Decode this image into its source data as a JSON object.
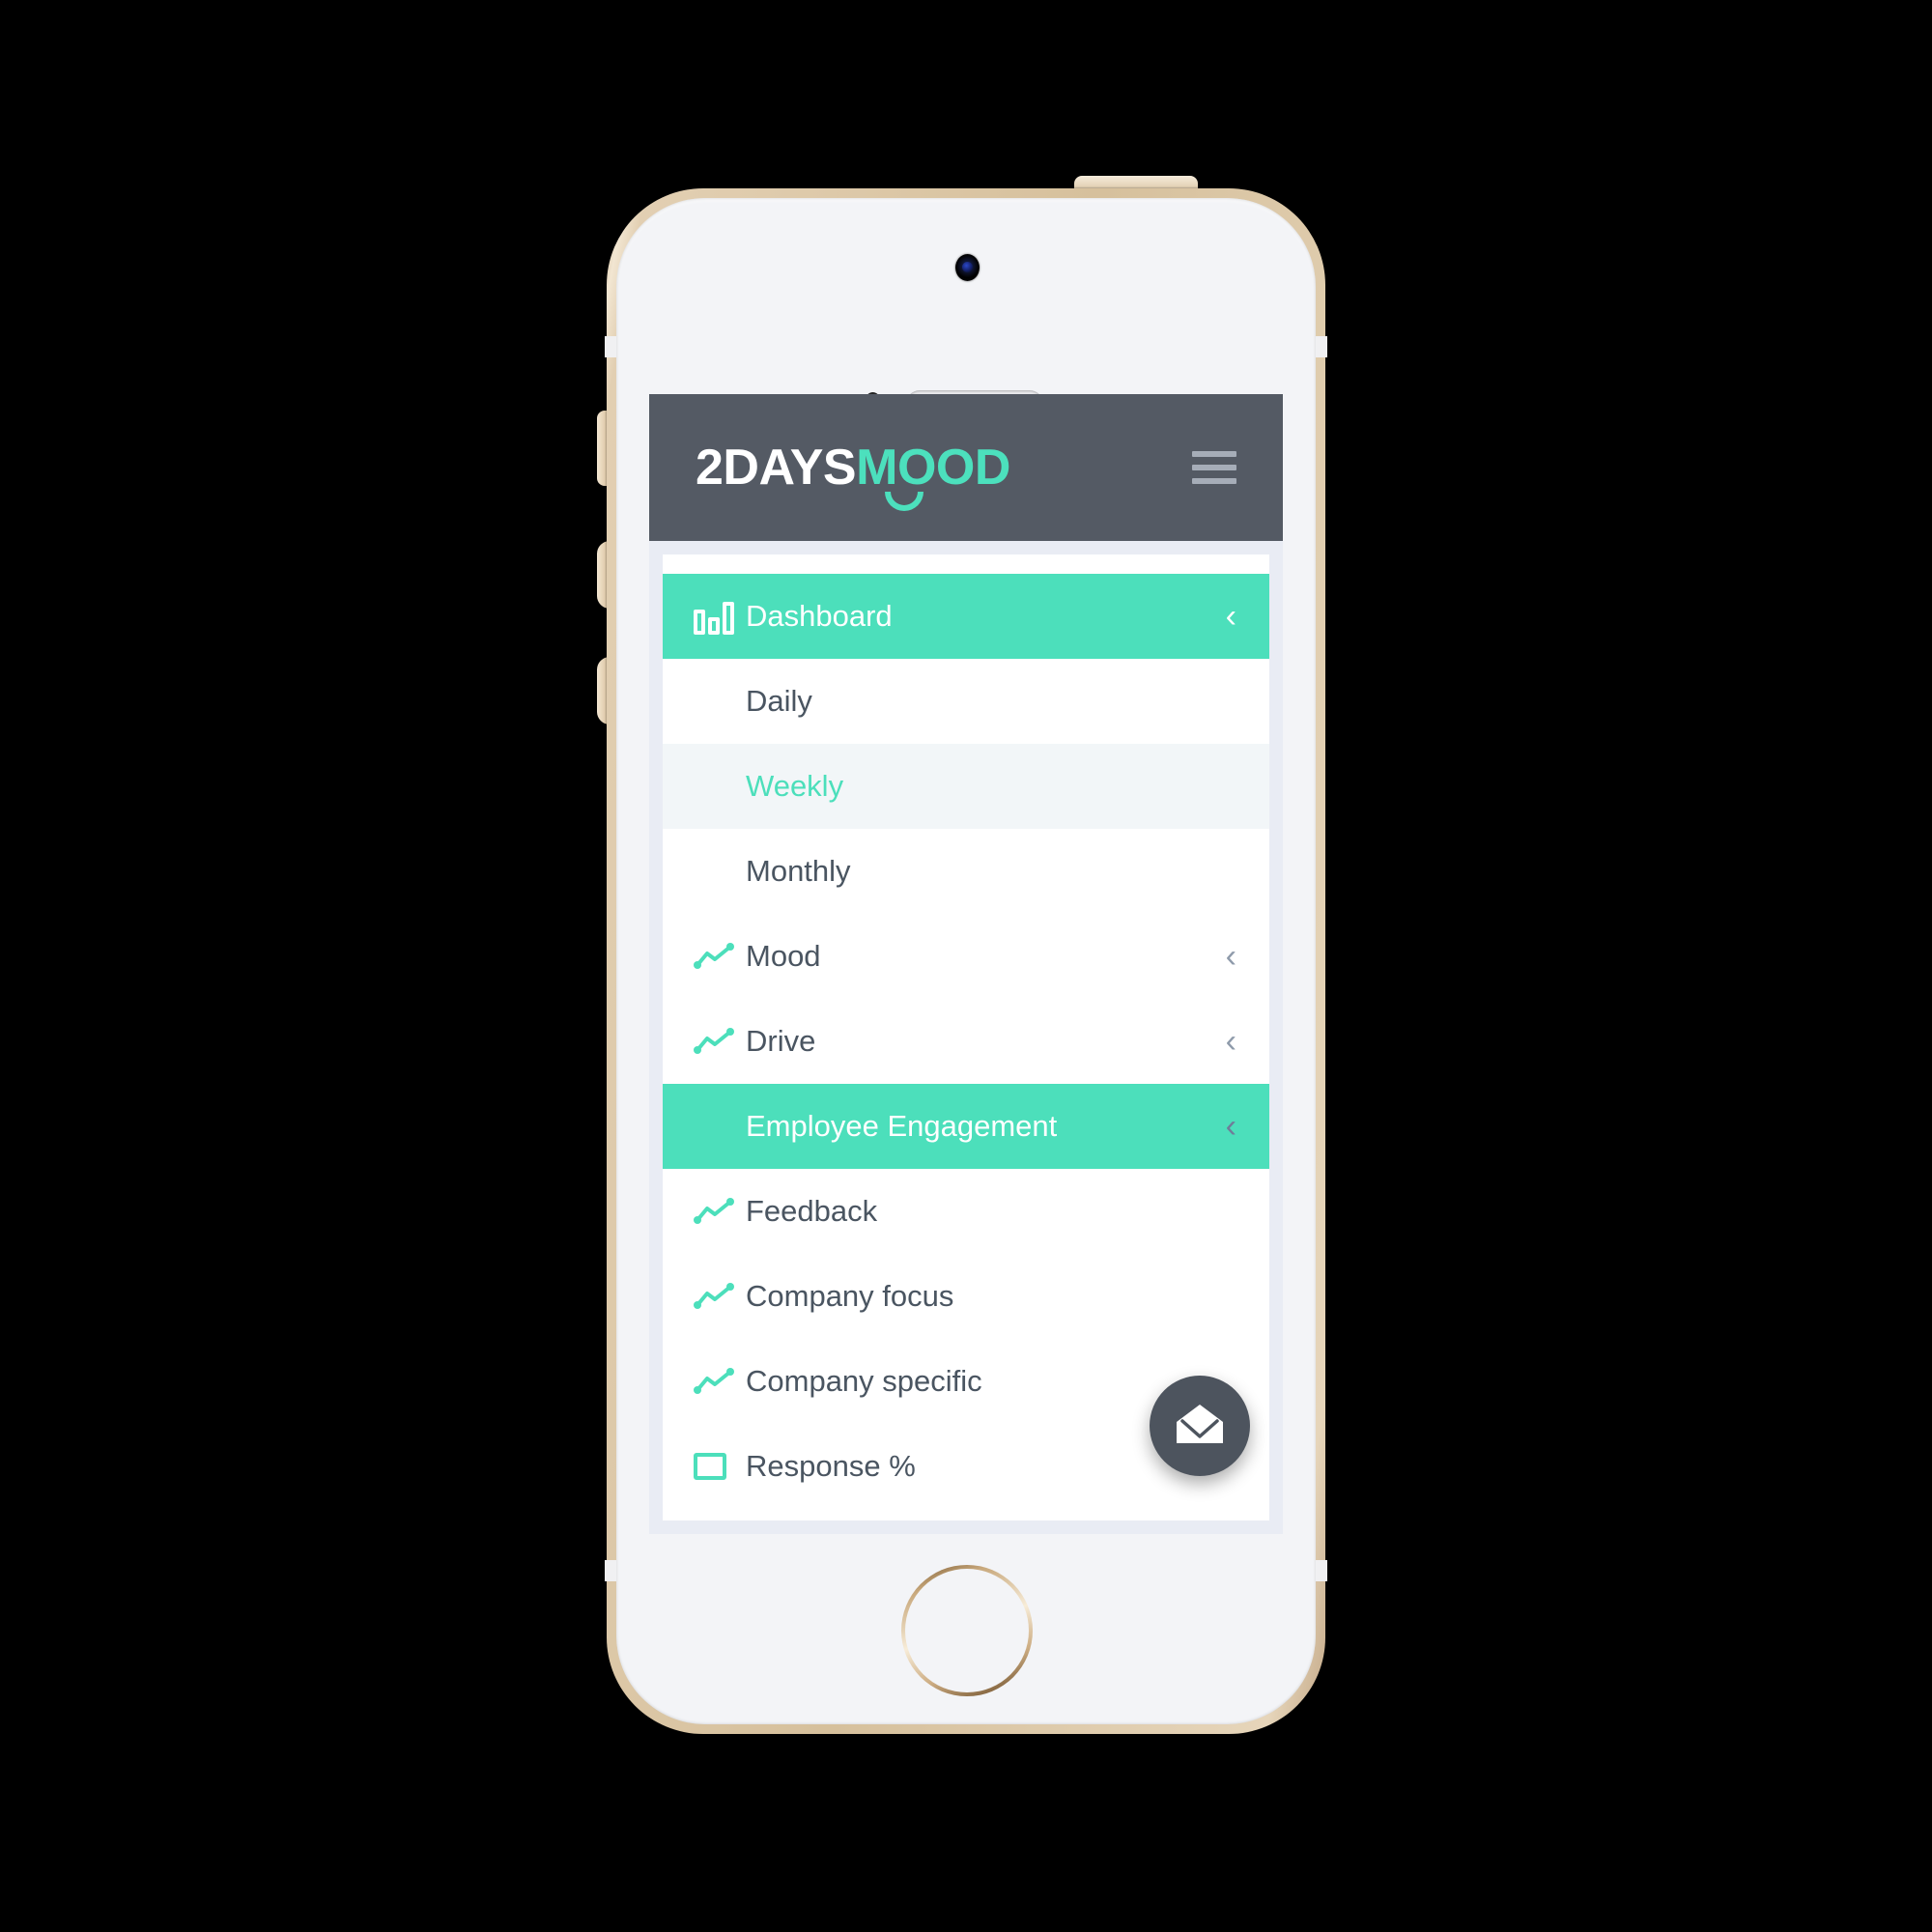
{
  "device": {
    "type": "iphone-5s-gold-mockup",
    "hardware": {
      "power_button": "power-button",
      "mute_switch": "mute-switch",
      "volume_up": "volume-up-button",
      "volume_down": "volume-down-button",
      "home_button": "home-button",
      "camera": "front-camera",
      "speaker": "earpiece-speaker",
      "proximity_sensor": "proximity-sensor"
    }
  },
  "colors": {
    "accent_green": "#4CDFBB",
    "header_slate": "#545A64",
    "text_slate": "#4A5561",
    "page_bg": "#E9ECF4",
    "selected_row_bg": "#F2F6F8",
    "fab_bg": "#4D545E",
    "chevron_gray": "#8F9BAB",
    "hamburger_gray": "#A6ADB8",
    "device_gold": "#D6C09C"
  },
  "header": {
    "logo_part_one": "2DAYS",
    "logo_part_two": "MOOD",
    "logo_smile_icon": "smile-curve-icon",
    "menu_button_icon": "hamburger-menu-icon"
  },
  "nav": {
    "items": [
      {
        "label": "Dashboard",
        "icon": "bar-chart-icon",
        "chevron": "‹",
        "state": "active",
        "level": "top"
      },
      {
        "label": "Daily",
        "icon": null,
        "chevron": null,
        "state": "normal",
        "level": "sub"
      },
      {
        "label": "Weekly",
        "icon": null,
        "chevron": null,
        "state": "selected",
        "level": "sub"
      },
      {
        "label": "Monthly",
        "icon": null,
        "chevron": null,
        "state": "normal",
        "level": "sub"
      },
      {
        "label": "Mood",
        "icon": "line-chart-icon",
        "chevron": "‹",
        "state": "normal",
        "level": "top"
      },
      {
        "label": "Drive",
        "icon": "line-chart-icon",
        "chevron": "‹",
        "state": "normal",
        "level": "top"
      },
      {
        "label": "Employee Engagement",
        "icon": null,
        "chevron": "‹",
        "state": "active-alt",
        "level": "sub"
      },
      {
        "label": "Feedback",
        "icon": "line-chart-icon",
        "chevron": null,
        "state": "normal",
        "level": "top"
      },
      {
        "label": "Company focus",
        "icon": "line-chart-icon",
        "chevron": null,
        "state": "normal",
        "level": "top"
      },
      {
        "label": "Company specific",
        "icon": "line-chart-icon",
        "chevron": null,
        "state": "normal",
        "level": "top"
      },
      {
        "label": "Response %",
        "icon": "square-outline-icon",
        "chevron": null,
        "state": "normal",
        "level": "top"
      }
    ]
  },
  "fab": {
    "icon": "open-envelope-icon",
    "label": "Contact"
  }
}
